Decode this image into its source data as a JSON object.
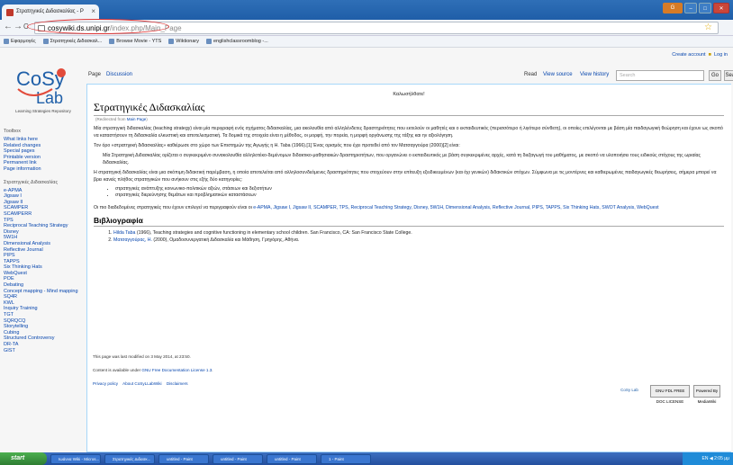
{
  "browser": {
    "tab_title": "Στρατηγικές Διδασκαλίας - P",
    "tab_close": "×",
    "window_user": "G",
    "url_domain": "cosywiki.ds.unipi.gr",
    "url_path": "/index.php/Main_Page",
    "nav_back": "←",
    "nav_forward": "→",
    "nav_reload": "C",
    "star": "☆",
    "bookmarks": [
      "Εφαρμογές",
      "Στρατηγικές Διδασκαλ...",
      "Browse Movie - YTS",
      "Wiktionary",
      "englishclassroomblog -..."
    ]
  },
  "personal": {
    "create_account": "Create account",
    "login": "Log in"
  },
  "logo": {
    "line1": "CoSy",
    "line2": "Lab",
    "tagline": "Learning Strategies Repository"
  },
  "tabs": {
    "page": "Page",
    "discussion": "Discussion",
    "read": "Read",
    "view_source": "View source",
    "view_history": "View history"
  },
  "search": {
    "placeholder": "Search",
    "go": "Go",
    "search": "Search"
  },
  "sidebar": {
    "toolbox_title": "Toolbox",
    "toolbox": [
      "What links here",
      "Related changes",
      "Special pages",
      "Printable version",
      "Permanent link",
      "Page information"
    ],
    "strategies_title": "Στρατηγικές Διδασκαλίας",
    "strategies": [
      "e-APMA",
      "Jigsaw I",
      "Jigsaw II",
      "SCAMPER",
      "SCAMPERR",
      "TPS",
      "Reciprocal Teaching Strategy",
      "Disney",
      "5W1H",
      "Dimensional Analysis",
      "Reflective Journal",
      "PIPS",
      "TAPPS",
      "Six Thinking Hats",
      "WebQuest",
      "POE",
      "Debating",
      "Concept mapping - Mind mapping",
      "SQ4R",
      "KWL",
      "Inquiry Training",
      "TGT",
      "SQRQCQ",
      "Storytelling",
      "Cubing",
      "Structured Controversy",
      "DR-TA",
      "GIST"
    ]
  },
  "content": {
    "sitenotice": "Καλωσήλθατε!",
    "title": "Στρατηγικές Διδασκαλίας",
    "redirect_prefix": "(Redirected from",
    "redirect_link": "Main Page",
    "redirect_suffix": ")",
    "p1": "Μία στρατηγική διδασκαλίας (teaching strategy) είναι μία περιγραφή ενός σχήματος διδασκαλίας, μια ακολουθία από αλληλένδετες δραστηριότητες που εκτελούν οι μαθητές και ο εκπαιδευτικός (περισσότερο ή λιγότερο σύνθετη), οι οποίες επιλέγονται με βάση μία παιδαγωγική θεώρηση και έχουν ως σκοπό να καταστήσουν τη διδασκαλία ελκυστική και αποτελεσματική. Τα δομικά της στοιχεία είναι η μέθοδος, οι μορφή, την πορεία, η μορφή οργάνωσης της τάξης και ην αξιολόγηση.",
    "p2": "Τον όρο «στρατηγική διδασκαλίας» καθιέρωσε στο χώρο των Επιστημών της Αγωγής η Η. Taba (1966).[1] Ένας ορισμός που έχει προτεθεί από τον Ματσαγγούρα (2000)[2] είναι:",
    "p3": "Μία Στρατηγική Διδασκαλίας ορίζεται ο συγκεκριμένο συνακολουθία αλληλοτέκο-δεμένομων διδακτικο-μαθησιακών δραστηριοτήτων, που οργανώνει ο εκπαιδευτικός με βάση συγκεκριμένες αρχές, κατά τη διεξαγωγή του μαθήματος, με σκοπό να υλοποιήσει τους ειδικούς στόχους της ωριαίας διδασκαλίας.",
    "p4": "Η στρατηγική διδασκαλίας είναι μια σκόπιμη διδακτική παρέμβαση, η οποία αποτελείται από αλληλοσυνδεόμενες δραστηριότητες που στοχεύουν στην επίτευξη εξειδικευμένων (και όχι γενικών) διδακτικών στόχων. Σύμφωνα με τις μοντέρνες και καθιερωμένες παιδαγωγικές θεωρήσεις, σήμερα μπορεί να βρει κανείς πλήθος στρατηγικών που ανήκουν στις εξής δύο κατηγορίες:",
    "bullets": [
      "στρατηγικές ανάπτυξης κοινωνικο-πολιτικών αξιών, στάσεων και δεξιοτήτων",
      "στρατηγικές διερεύνησης θεμάτων και προβληματικών καταστάσεων"
    ],
    "p5_prefix": "Οι πιο διαδεδομένες στρατηγικές που έχουν επιλεγεί να περιγραφούν είναι οι",
    "p5_links": "e-APMA, Jigsaw I, Jigsaw II, SCAMPER, TPS, Reciprocal Teaching Strategy, Disney, 5W1H, Dimensional Analysis, Reflective Journal, PIPS, TAPPS, Six Thinking Hats, SWOT Analysis, WebQuest",
    "biblio_title": "Βιβλιογραφία",
    "refs": [
      {
        "author": "Hilda Taba",
        "text": " (1966), Teaching strategies and cognitive functioning in elementary school children. San Francisco, CA: San Francisco State College."
      },
      {
        "author": "Ματσαγγούρας, Η.",
        "text": " (2000), Ομαδοσυνεργατική Διδασκαλία και Μάθηση, Γρηγόρης, Αθήνα."
      }
    ]
  },
  "footer": {
    "lastmod": "This page was last modified on 3 May 2014, at 23:50.",
    "license_prefix": "Content is available under",
    "license_link": "GNU Free Documentation License 1.3",
    "links": [
      "Privacy policy",
      "About CoSyLLabWiki",
      "Disclaimers"
    ],
    "badges": [
      "CoSy Lab",
      "GNU FDL FREE DOC LICENSE",
      "Powered By MediaWiki"
    ]
  },
  "taskbar": {
    "start": "start",
    "items": [
      "Ιωάννα Wiki - Micros...",
      "Στρατηγικές Διδασκ...",
      "untitled - Paint",
      "untitled - Paint",
      "untitled - Paint",
      "1 - Paint"
    ],
    "tray": "EN  ◀  2:05 μμ"
  },
  "colors": {
    "link": "#0645ad",
    "chrome_blue": "#2f6fb7",
    "taskbar": "#244f9e",
    "start": "#2e7d32"
  }
}
